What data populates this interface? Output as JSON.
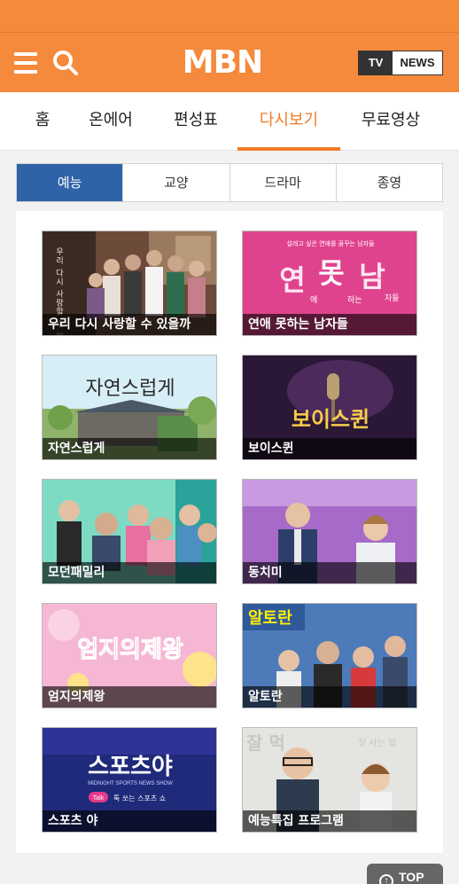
{
  "header": {
    "logo": "MBN",
    "tv_label": "TV",
    "news_label": "NEWS",
    "icons": [
      "menu-icon",
      "search-icon"
    ],
    "color": "#f58a3c"
  },
  "gnb": {
    "items": [
      "홈",
      "온에어",
      "편성표",
      "다시보기",
      "무료영상"
    ],
    "active": "다시보기",
    "active_color": "#f07c2a"
  },
  "subtabs": {
    "items": [
      "예능",
      "교양",
      "드라마",
      "종영"
    ],
    "active": "예능",
    "active_color": "#2f63a8"
  },
  "programs": [
    {
      "title": "우리 다시 사랑할 수 있을까"
    },
    {
      "title": "연애 못하는 남자들"
    },
    {
      "title": "자연스럽게"
    },
    {
      "title": "보이스퀸"
    },
    {
      "title": "모던패밀리"
    },
    {
      "title": "동치미"
    },
    {
      "title": "엄지의제왕"
    },
    {
      "title": "알토란"
    },
    {
      "title": "스포츠 야"
    },
    {
      "title": "예능특집 프로그램"
    }
  ],
  "thumb_text": {
    "t1_vertical": "우리 다시 사랑할 수 있을까",
    "t2_small": "설레고 싶은 연애를 꿈꾸는 남자들",
    "t2_main1": "연",
    "t2_main2": "못",
    "t2_main3": "남",
    "t2_sub1": "애",
    "t2_sub2": "하는",
    "t2_sub3": "자들",
    "t3_main": "자연스럽게",
    "t4_main": "보이스퀸",
    "t7_main": "엄지의제왕",
    "t8_main": "알토란",
    "t9_main": "스포츠야",
    "t9_sub": "MIDNIGHT SPORTS NEWS SHOW",
    "t9_tag": "Talk",
    "t9_tagline": "톡 쏘는 스포츠 쇼",
    "t10_main": "잘 먹",
    "t10_sub": "잘 사는 법"
  },
  "top_button": {
    "label": "TOP"
  }
}
